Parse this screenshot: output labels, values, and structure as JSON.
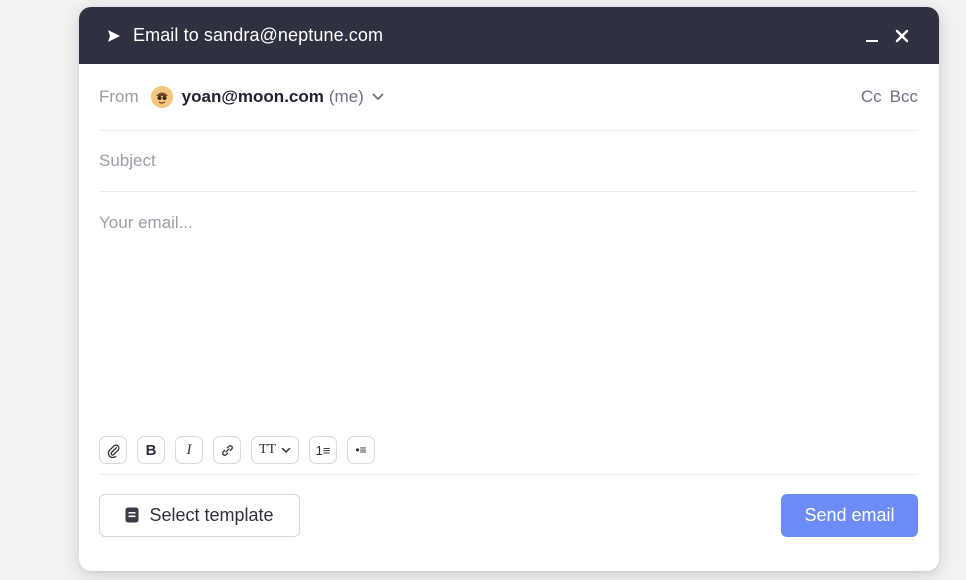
{
  "header": {
    "title": "Email to sandra@neptune.com"
  },
  "from": {
    "label": "From",
    "email": "yoan@moon.com",
    "suffix": "(me)",
    "cc_label": "Cc",
    "bcc_label": "Bcc"
  },
  "subject": {
    "placeholder": "Subject",
    "value": ""
  },
  "body": {
    "placeholder": "Your email...",
    "value": ""
  },
  "toolbar": {
    "bold": "B",
    "italic": "I",
    "text_size": "TT",
    "ordered_list": "1≡",
    "bullet_list": "•≡"
  },
  "footer": {
    "template_label": "Select template",
    "send_label": "Send email"
  },
  "colors": {
    "header_bg": "#2f3140",
    "send_button": "#6d8cf7"
  }
}
